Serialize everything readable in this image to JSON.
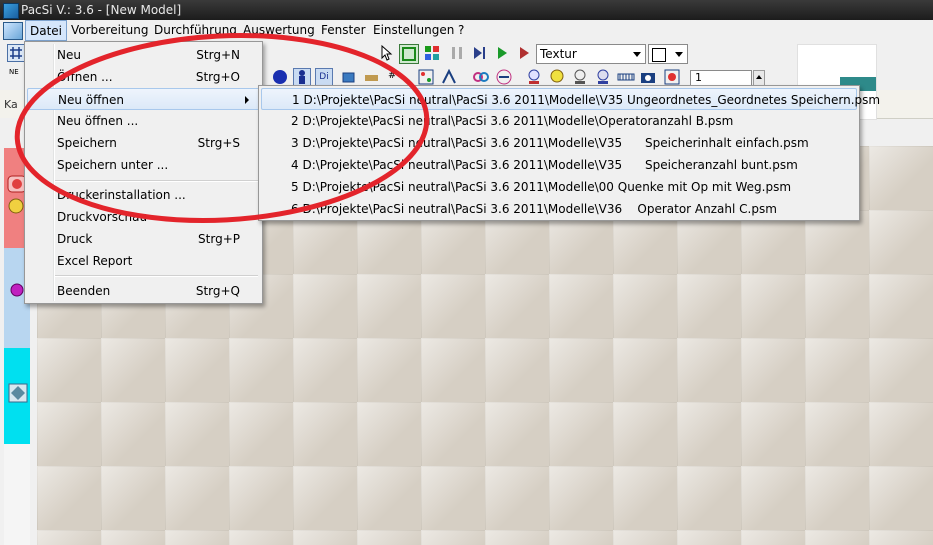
{
  "window": {
    "title": "PacSi V.: 3.6 - [New Model]"
  },
  "menubar": {
    "items": [
      "Datei",
      "Vorbereitung",
      "Durchführung",
      "Auswertung",
      "Fenster",
      "Einstellungen",
      "?"
    ]
  },
  "toolbar": {
    "texture_combo": "Textur",
    "counter_value": "1",
    "kat_label": "Ka"
  },
  "datei_menu": {
    "items": [
      {
        "label": "Neu",
        "shortcut": "Strg+N"
      },
      {
        "label": "Öffnen ...",
        "shortcut": "Strg+O"
      },
      {
        "label": "Neu öffnen",
        "shortcut": ""
      },
      {
        "label": "Neu öffnen ...",
        "shortcut": ""
      },
      {
        "label": "Speichern",
        "shortcut": "Strg+S"
      },
      {
        "label": "Speichern unter ...",
        "shortcut": ""
      },
      {
        "label": "Druckerinstallation ...",
        "shortcut": ""
      },
      {
        "label": "Druckvorschau",
        "shortcut": ""
      },
      {
        "label": "Druck",
        "shortcut": "Strg+P"
      },
      {
        "label": "Excel Report",
        "shortcut": ""
      },
      {
        "label": "Beenden",
        "shortcut": "Strg+Q"
      }
    ]
  },
  "recent_files": {
    "items": [
      "1 D:\\Projekte\\PacSi neutral\\PacSi 3.6 2011\\Modelle\\V35 Ungeordnetes_Geordnetes Speichern.psm",
      "2 D:\\Projekte\\PacSi neutral\\PacSi 3.6 2011\\Modelle\\Operatoranzahl B.psm",
      "3 D:\\Projekte\\PacSi neutral\\PacSi 3.6 2011\\Modelle\\V35      Speicherinhalt einfach.psm",
      "4 D:\\Projekte\\PacSi neutral\\PacSi 3.6 2011\\Modelle\\V35      Speicheranzahl bunt.psm",
      "5 D:\\Projekte\\PacSi neutral\\PacSi 3.6 2011\\Modelle\\00 Quenke mit Op mit Weg.psm",
      "6 D:\\Projekte\\PacSi neutral\\PacSi 3.6 2011\\Modelle\\V36    Operator Anzahl C.psm"
    ]
  },
  "annotation": {
    "color": "#e3242b",
    "shape": "ellipse"
  }
}
